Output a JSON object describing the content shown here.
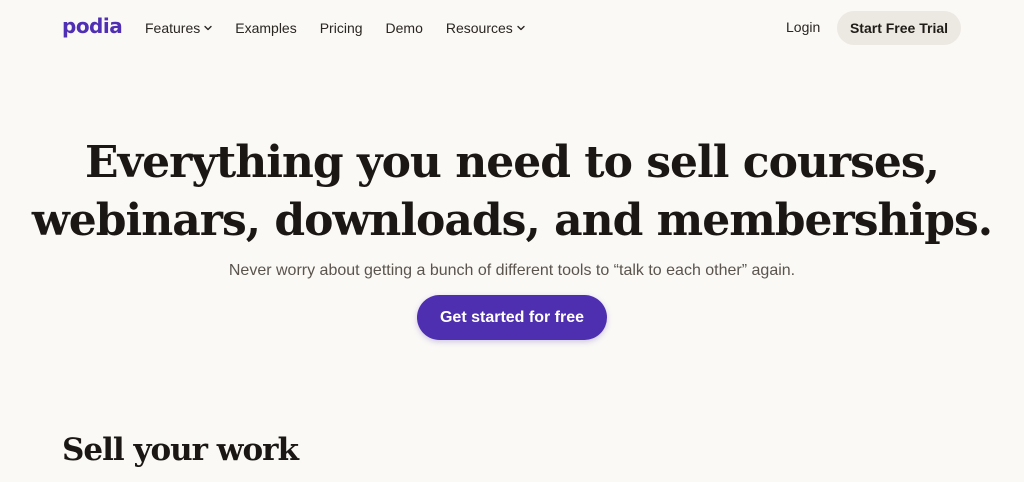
{
  "header": {
    "logo": "podia",
    "nav": [
      {
        "label": "Features",
        "has_dropdown": true
      },
      {
        "label": "Examples",
        "has_dropdown": false
      },
      {
        "label": "Pricing",
        "has_dropdown": false
      },
      {
        "label": "Demo",
        "has_dropdown": false
      },
      {
        "label": "Resources",
        "has_dropdown": true
      }
    ],
    "login_label": "Login",
    "trial_label": "Start Free Trial"
  },
  "hero": {
    "title_line1": "Everything you need to sell courses,",
    "title_line2": "webinars, downloads, and memberships.",
    "subtitle": "Never worry about getting a bunch of different tools to “talk to each other” again.",
    "cta_label": "Get started for free"
  },
  "section": {
    "title": "Sell your work"
  },
  "colors": {
    "background": "#fbf9f6",
    "brand": "#4f2fb3",
    "cta": "#4d2fb0",
    "trial_button": "#ece8e2"
  },
  "icons": {
    "dropdown": "chevron-down-icon"
  }
}
